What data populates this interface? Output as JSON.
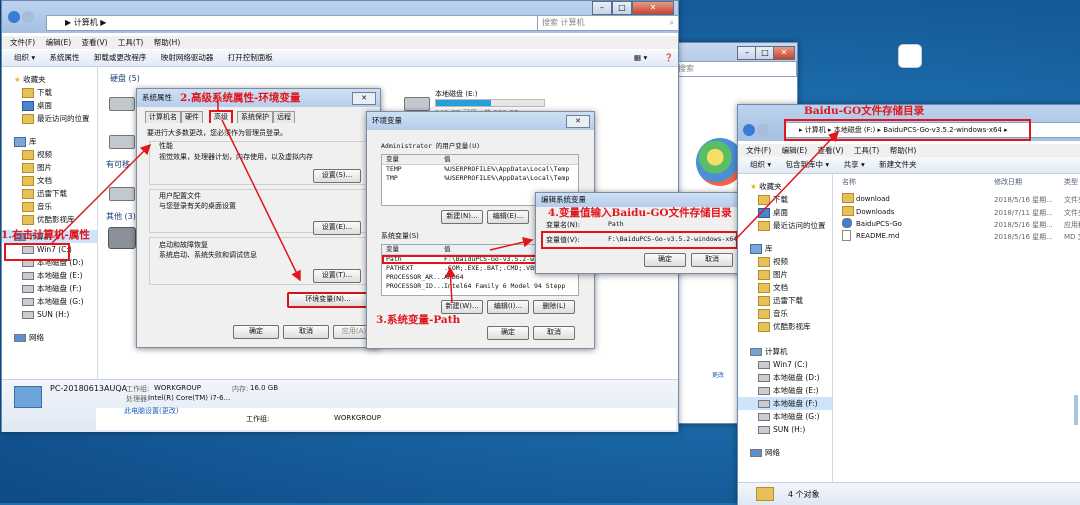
{
  "explorer_main": {
    "breadcrumb": "▶ 计算机 ▶",
    "search_placeholder": "搜索 计算机",
    "menu": [
      "文件(F)",
      "编辑(E)",
      "查看(V)",
      "工具(T)",
      "帮助(H)"
    ],
    "commands": [
      "组织 ▾",
      "系统属性",
      "卸载或更改程序",
      "映射网络驱动器",
      "打开控制面板"
    ],
    "nav": {
      "favorites": "收藏夹",
      "fav_items": [
        "下载",
        "桌面",
        "最近访问的位置"
      ],
      "libraries": "库",
      "lib_items": [
        "视频",
        "图片",
        "文档",
        "迅雷下载",
        "音乐",
        "优酷影视库"
      ],
      "computer": "计算机",
      "drives": [
        "Win7 (C:)",
        "本地磁盘 (D:)",
        "本地磁盘 (E:)",
        "本地磁盘 (F:)",
        "本地磁盘 (G:)",
        "SUN (H:)"
      ],
      "network": "网络"
    },
    "content": {
      "hdd_header": "硬盘 (5)",
      "removable_header": "有可移",
      "other_header": "其他 (3)",
      "drive_e_name": "本地磁盘 (E:)",
      "drive_e_free": "146 GB 可用，共 298 GB",
      "drive_e_fill_fraction": 0.51
    },
    "details": {
      "pc_name": "PC-20180613AUQA",
      "workgroup_label": "工作组:",
      "workgroup": "WORKGROUP",
      "memory_label": "内存:",
      "memory": "16.0 GB",
      "cpu_label": "处理器:",
      "cpu": "Intel(R) Core(TM) i7-6...",
      "bottom_workgroup_label": "工作组:",
      "bottom_workgroup": "WORKGROUP",
      "bottom_link": "此电脑设置(更改)"
    }
  },
  "sys_props": {
    "title": "系统属性",
    "tabs": [
      "计算机名",
      "硬件",
      "高级",
      "系统保护",
      "远程"
    ],
    "admin_note": "要进行大多数更改，您必须作为管理员登录。",
    "perf_title": "性能",
    "perf_desc": "视觉效果，处理器计划，内存使用，以及虚拟内存",
    "profile_title": "用户配置文件",
    "profile_desc": "与您登录有关的桌面设置",
    "startup_title": "启动和故障恢复",
    "startup_desc": "系统启动、系统失败和调试信息",
    "settings_btn": "设置(S)...",
    "settings_btn2": "设置(E)...",
    "settings_btn3": "设置(T)...",
    "env_btn": "环境变量(N)...",
    "ok": "确定",
    "cancel": "取消",
    "apply": "应用(A)"
  },
  "env_vars": {
    "title": "环境变量",
    "user_section": "Administrator 的用户变量(U)",
    "col_var": "变量",
    "col_val": "值",
    "user_rows": [
      [
        "TEMP",
        "%USERPROFILE%\\AppData\\Local\\Temp"
      ],
      [
        "TMP",
        "%USERPROFILE%\\AppData\\Local\\Temp"
      ]
    ],
    "new_btn": "新建(N)...",
    "edit_btn": "编辑(E)...",
    "sys_section": "系统变量(S)",
    "sys_rows": [
      [
        "Path",
        "F:\\BaiduPCS-Go-v3.5.2-windo"
      ],
      [
        "PATHEXT",
        ".COM;.EXE;.BAT;.CMD;.VBS;.V"
      ],
      [
        "PROCESSOR_AR...",
        "AMD64"
      ],
      [
        "PROCESSOR_ID...",
        "Intel64 Family 6 Model 94 Stepp"
      ]
    ],
    "new_btn2": "新建(W)...",
    "edit_btn2": "编辑(I)...",
    "delete_btn": "删除(L)",
    "ok": "确定",
    "cancel": "取消"
  },
  "edit_var": {
    "title": "编辑系统变量",
    "name_label": "变量名(N):",
    "name_value": "Path",
    "value_label": "变量值(V):",
    "value_value": "F:\\BaiduPCS-Go-v3.5.2-windows-x64",
    "ok": "确定",
    "cancel": "取消"
  },
  "explorer_right": {
    "breadcrumb": "▸ 计算机 ▸ 本地磁盘 (F:) ▸ BaiduPCS-Go-v3.5.2-windows-x64 ▸",
    "menu": [
      "文件(F)",
      "编辑(E)",
      "查看(V)",
      "工具(T)",
      "帮助(H)"
    ],
    "commands": [
      "组织 ▾",
      "包含到库中 ▾",
      "共享 ▾",
      "新建文件夹"
    ],
    "col_name": "名称",
    "col_date": "修改日期",
    "col_type": "类型",
    "files": [
      {
        "name": "download",
        "date": "2018/5/16 星期...",
        "type": "文件夹",
        "kind": "folder"
      },
      {
        "name": "Downloads",
        "date": "2018/7/11 星期...",
        "type": "文件夹",
        "kind": "folder"
      },
      {
        "name": "BaiduPCS-Go",
        "date": "2018/5/16 星期...",
        "type": "应用程",
        "kind": "app"
      },
      {
        "name": "README.md",
        "date": "2018/5/16 星期...",
        "type": "MD 文",
        "kind": "file"
      }
    ],
    "nav_favorites": "收藏夹",
    "nav_fav_items": [
      "下载",
      "桌面",
      "最近访问的位置"
    ],
    "nav_libraries": "库",
    "nav_lib_items": [
      "视频",
      "图片",
      "文档",
      "迅雷下载",
      "音乐",
      "优酷影视库"
    ],
    "nav_computer": "计算机",
    "nav_drives": [
      "Win7 (C:)",
      "本地磁盘 (D:)",
      "本地磁盘 (E:)",
      "本地磁盘 (F:)",
      "本地磁盘 (G:)",
      "SUN (H:)"
    ],
    "nav_network": "网络",
    "status": "4 个对象"
  },
  "background_window": {
    "search_placeholder": "搜索"
  },
  "annotations": {
    "step1": "1.右击计算机-属性",
    "step2": "2.高级系统属性-环境变量",
    "step3": "3.系统变量-Path",
    "step4": "4.变量值输入Baidu-GO文件存储目录",
    "top_right": "Baidu-GO文件存储目录"
  },
  "colors": {
    "annotation": "#e0161c",
    "title_bar": "#b6cdea",
    "desktop": "#1b6aa8"
  }
}
